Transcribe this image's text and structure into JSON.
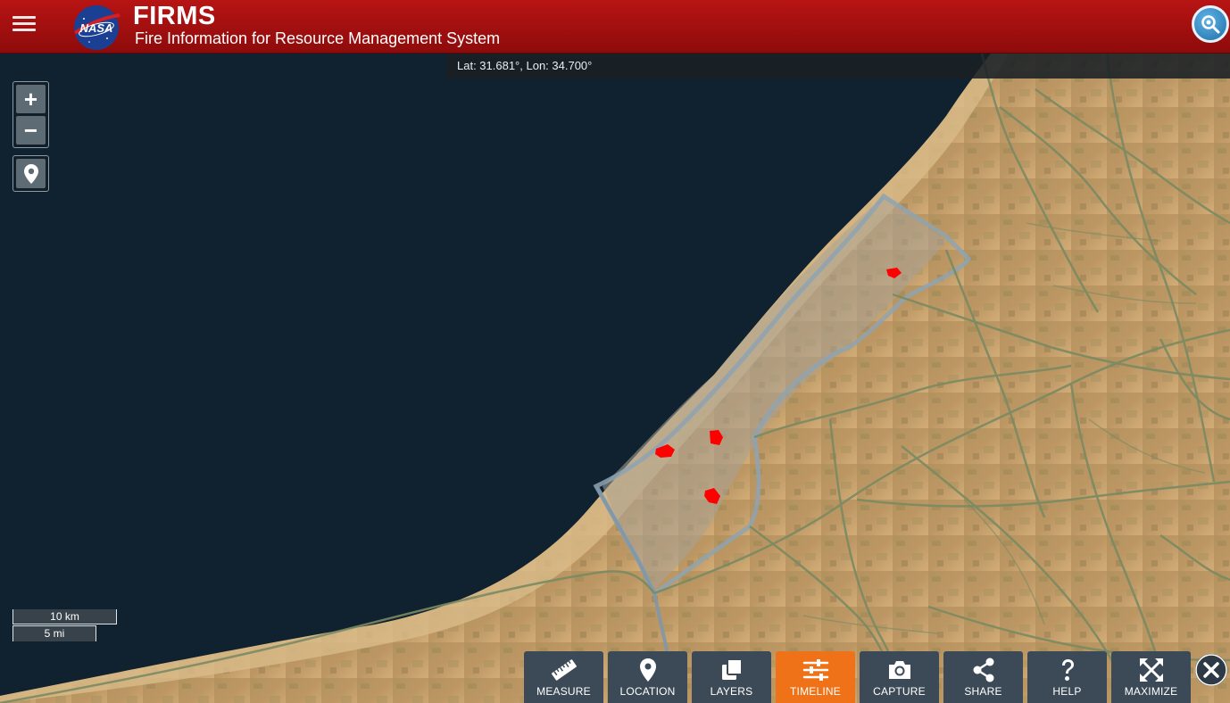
{
  "header": {
    "title": "FIRMS",
    "subtitle": "Fire Information for Resource Management System",
    "logo_text": "NASA",
    "icons": {
      "menu": "hamburger-menu-icon",
      "search": "search-icon"
    }
  },
  "coordinates": {
    "text": "Lat: 31.681°, Lon: 34.700°"
  },
  "map_controls": {
    "zoom_in_label": "+",
    "zoom_out_label": "−",
    "location_icon": "map-pin-icon"
  },
  "scale_bar": {
    "km_label": "10 km",
    "mi_label": "5 mi"
  },
  "toolbar": {
    "active": "TIMELINE",
    "active_color": "#f07218",
    "button_color": "#3b4a56",
    "buttons": [
      {
        "label": "MEASURE",
        "icon": "ruler-icon"
      },
      {
        "label": "LOCATION",
        "icon": "map-pin-icon"
      },
      {
        "label": "LAYERS",
        "icon": "layers-icon"
      },
      {
        "label": "TIMELINE",
        "icon": "sliders-icon"
      },
      {
        "label": "CAPTURE",
        "icon": "camera-icon"
      },
      {
        "label": "SHARE",
        "icon": "share-icon"
      },
      {
        "label": "HELP",
        "icon": "question-icon"
      },
      {
        "label": "MAXIMIZE",
        "icon": "maximize-icon"
      }
    ],
    "close_icon": "close-icon"
  },
  "colors": {
    "header": "#a30f0f",
    "sea": "#10222f",
    "land": "#c29a62",
    "fire_hotspot": "#ff0000"
  }
}
